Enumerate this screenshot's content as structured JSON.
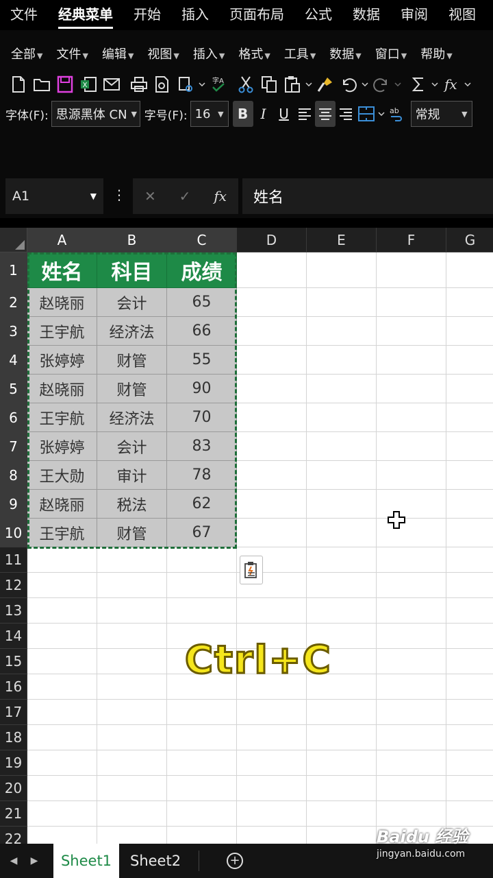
{
  "ribbon_tabs": [
    "文件",
    "经典菜单",
    "开始",
    "插入",
    "页面布局",
    "公式",
    "数据",
    "审阅",
    "视图"
  ],
  "active_tab_index": 1,
  "classic_menu": [
    "全部",
    "文件",
    "编辑",
    "视图",
    "插入",
    "格式",
    "工具",
    "数据",
    "窗口",
    "帮助"
  ],
  "format_bar": {
    "font_label": "字体(F):",
    "font_value": "思源黑体 CN",
    "size_label": "字号(F):",
    "size_value": "16",
    "bold": "B",
    "italic": "I",
    "underline": "U",
    "number_format": "常规"
  },
  "formula_bar": {
    "name_box": "A1",
    "fx": "fx",
    "content": "姓名"
  },
  "columns": [
    "A",
    "B",
    "C",
    "D",
    "E",
    "F",
    "G"
  ],
  "rows": [
    "1",
    "2",
    "3",
    "4",
    "5",
    "6",
    "7",
    "8",
    "9",
    "10",
    "11",
    "12",
    "13",
    "14",
    "15",
    "16",
    "17",
    "18",
    "19",
    "20",
    "21",
    "22"
  ],
  "table": {
    "header": [
      "姓名",
      "科目",
      "成绩"
    ],
    "rows": [
      [
        "赵晓丽",
        "会计",
        "65"
      ],
      [
        "王宇航",
        "经济法",
        "66"
      ],
      [
        "张婷婷",
        "财管",
        "55"
      ],
      [
        "赵晓丽",
        "财管",
        "90"
      ],
      [
        "王宇航",
        "经济法",
        "70"
      ],
      [
        "张婷婷",
        "会计",
        "83"
      ],
      [
        "王大勋",
        "审计",
        "78"
      ],
      [
        "赵晓丽",
        "税法",
        "62"
      ],
      [
        "王宇航",
        "财管",
        "67"
      ]
    ]
  },
  "overlay_caption": "Ctrl+C",
  "sheets": [
    "Sheet1",
    "Sheet2"
  ],
  "active_sheet": "Sheet1",
  "watermark": {
    "main": "Baidu 经验",
    "sub": "jingyan.baidu.com"
  },
  "colors": {
    "header_green": "#1e8a47",
    "data_gray": "#c8c8c8",
    "caption_yellow": "#f5e61c"
  }
}
